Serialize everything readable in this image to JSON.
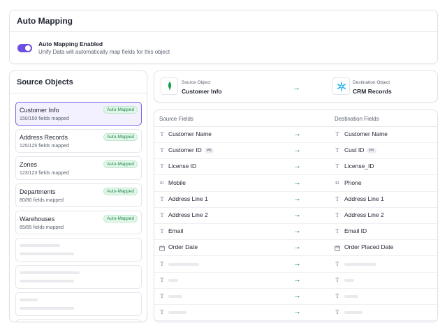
{
  "auto_mapping": {
    "title": "Auto Mapping",
    "enabled_label": "Auto Mapping Enabled",
    "description": "Unify Data will automatically map fields for this object",
    "toggle_on": true
  },
  "source_objects": {
    "title": "Source Objects",
    "items": [
      {
        "name": "Customer Info",
        "count": "150/150 fields mapped",
        "badge": "Auto-Mapped",
        "active": true
      },
      {
        "name": "Address Records",
        "count": "125/125 fields mapped",
        "badge": "Auto-Mapped",
        "active": false
      },
      {
        "name": "Zones",
        "count": "123/123 fields mapped",
        "badge": "Auto-Mapped",
        "active": false
      },
      {
        "name": "Departments",
        "count": "80/80 fields mapped",
        "badge": "Auto-Mapped",
        "active": false
      },
      {
        "name": "Warehouses",
        "count": "65/65 fields mapped",
        "badge": "Auto-Mapped",
        "active": false
      }
    ]
  },
  "header": {
    "source_label": "Source Object",
    "source_value": "Customer Info",
    "source_icon": "mongodb-leaf-icon",
    "dest_label": "Destination Object",
    "dest_value": "CRM Records",
    "dest_icon": "salesforce-snowflake-icon",
    "arrow": "→"
  },
  "fields": {
    "source_header": "Source Fields",
    "dest_header": "Destination Fields",
    "rows": [
      {
        "src_type": "T",
        "src": "Customer Name",
        "src_pk": "",
        "dst_type": "T",
        "dst": "Customer Name",
        "dst_pk": ""
      },
      {
        "src_type": "T",
        "src": "Customer ID",
        "src_pk": "PK",
        "dst_type": "T",
        "dst": "Cust ID",
        "dst_pk": "PK"
      },
      {
        "src_type": "T",
        "src": "License ID",
        "src_pk": "",
        "dst_type": "T",
        "dst": "License_ID",
        "dst_pk": ""
      },
      {
        "src_type": "$1",
        "src": "Mobile",
        "src_pk": "",
        "dst_type": "$1",
        "dst": "Phone",
        "dst_pk": ""
      },
      {
        "src_type": "T",
        "src": "Address Line 1",
        "src_pk": "",
        "dst_type": "T",
        "dst": "Address Line 1",
        "dst_pk": ""
      },
      {
        "src_type": "T",
        "src": "Address Line 2",
        "src_pk": "",
        "dst_type": "T",
        "dst": "Address Line 2",
        "dst_pk": ""
      },
      {
        "src_type": "T",
        "src": "Email",
        "src_pk": "",
        "dst_type": "T",
        "dst": "Email ID",
        "dst_pk": ""
      },
      {
        "src_type": "cal",
        "src": "Order Date",
        "src_pk": "",
        "dst_type": "cal",
        "dst": "Order Placed Date",
        "dst_pk": ""
      }
    ],
    "arrow": "→",
    "placeholder_type": "T"
  },
  "colors": {
    "accent": "#6d4ee0",
    "success": "#1f8a4c",
    "badge_bg": "#e3f6ea"
  }
}
